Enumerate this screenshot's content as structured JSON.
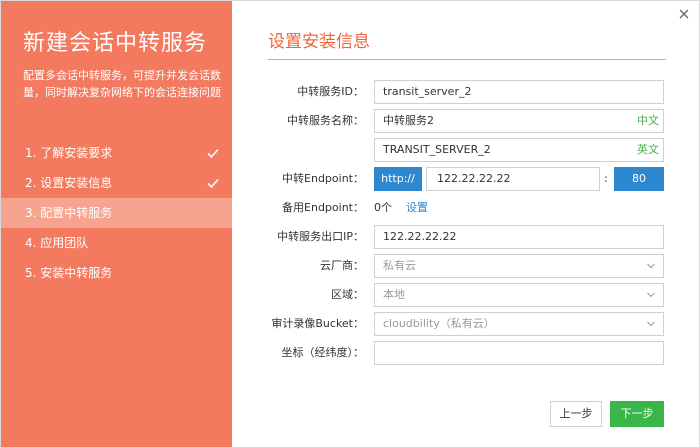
{
  "sidebar": {
    "title": "新建会话中转服务",
    "description": "配置多会话中转服务，可提升并发会话数量，同时解决复杂网络下的会话连接问题",
    "steps": [
      {
        "label": "1. 了解安装要求",
        "done": true
      },
      {
        "label": "2. 设置安装信息",
        "done": true
      },
      {
        "label": "3. 配置中转服务",
        "active": true
      },
      {
        "label": "4. 应用团队"
      },
      {
        "label": "5. 安装中转服务"
      }
    ]
  },
  "main": {
    "title": "设置安装信息",
    "fields": {
      "service_id": {
        "label": "中转服务ID：",
        "value": "transit_server_2"
      },
      "service_name": {
        "label": "中转服务名称：",
        "value_cn": "中转服务2",
        "tag_cn": "中文",
        "value_en": "TRANSIT_SERVER_2",
        "tag_en": "英文"
      },
      "endpoint": {
        "label": "中转Endpoint：",
        "protocol": "http://",
        "host": "122.22.22.22",
        "colon": ":",
        "port": "80"
      },
      "backup_endpoint": {
        "label": "备用Endpoint：",
        "count": "0个",
        "link": "设置"
      },
      "exit_ip": {
        "label": "中转服务出口IP：",
        "value": "122.22.22.22"
      },
      "cloud_vendor": {
        "label": "云厂商：",
        "value": "私有云"
      },
      "region": {
        "label": "区域：",
        "value": "本地"
      },
      "bucket": {
        "label": "审计录像Bucket：",
        "value": "cloudbility（私有云）"
      },
      "coordinates": {
        "label": "坐标（经纬度）：",
        "value": ""
      }
    },
    "buttons": {
      "prev": "上一步",
      "next": "下一步"
    }
  },
  "colors": {
    "accent": "#f37a5e",
    "title": "#f0643c",
    "primary_blue": "#2e88d0",
    "success_green": "#3ab54a"
  }
}
